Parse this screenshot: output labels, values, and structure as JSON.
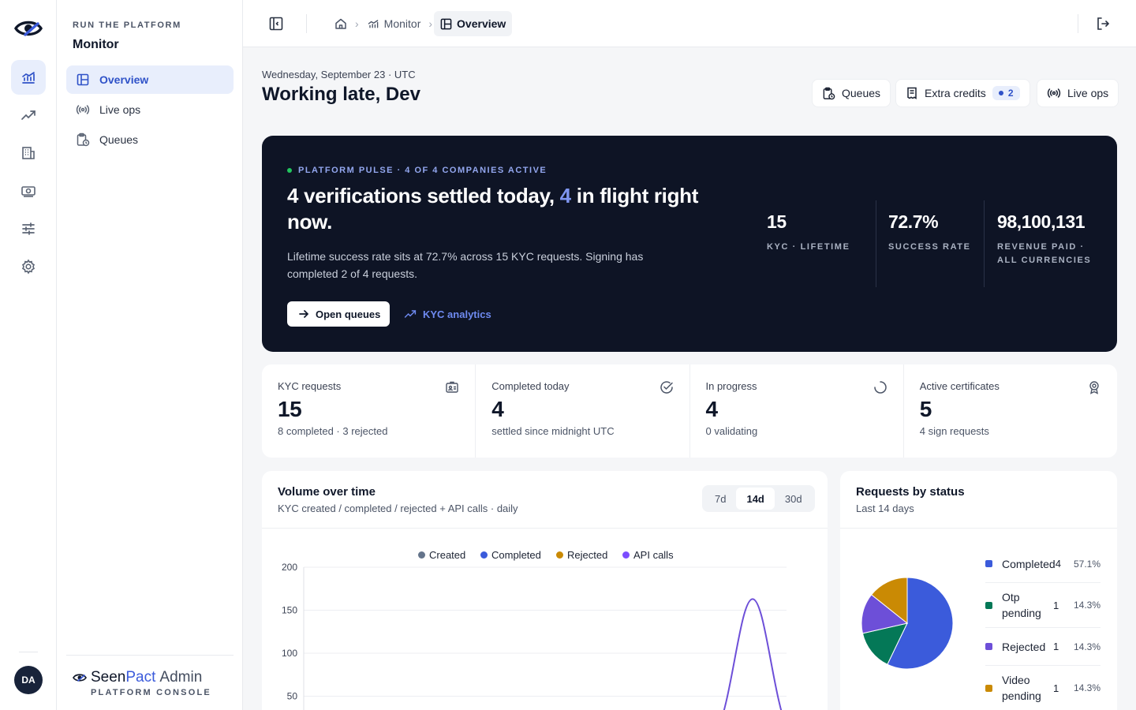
{
  "colors": {
    "accent": "#3b5bdb",
    "hero_bg": "#0e1425",
    "created": "#64748b",
    "completed": "#3b5bdb",
    "rejected": "#ca8a04",
    "api": "#7c4dff",
    "otp": "#047857",
    "video": "#ca8a04",
    "rejected_status": "#6d4fd8"
  },
  "rail": {
    "avatar": "DA"
  },
  "sidenav": {
    "eyebrow": "RUN THE PLATFORM",
    "title": "Monitor",
    "items": [
      {
        "label": "Overview",
        "icon": "layout-icon"
      },
      {
        "label": "Live ops",
        "icon": "broadcast-icon"
      },
      {
        "label": "Queues",
        "icon": "clipboard-clock-icon"
      }
    ],
    "brand_seen": "Seen",
    "brand_pact": "Pact",
    "brand_admin": "Admin",
    "brand_sub": "PLATFORM CONSOLE"
  },
  "topbar": {
    "crumbs": [
      {
        "label": "Monitor"
      },
      {
        "label": "Overview"
      }
    ]
  },
  "header": {
    "date": "Wednesday, September 23 · UTC",
    "greeting": "Working late, Dev",
    "buttons": {
      "queues": "Queues",
      "extra_credits": "Extra credits",
      "extra_credits_count": "2",
      "live_ops": "Live ops"
    }
  },
  "hero": {
    "pulse": "PLATFORM PULSE · 4 OF 4 COMPANIES ACTIVE",
    "headline_a": "4 verifications settled today, ",
    "headline_accent": "4",
    "headline_b": " in flight right now.",
    "body": "Lifetime success rate sits at 72.7% across 15 KYC requests. Signing has completed 2 of 4 requests.",
    "open_queues": "Open queues",
    "kyc_analytics": "KYC analytics",
    "stats": [
      {
        "value": "15",
        "label": "KYC · LIFETIME"
      },
      {
        "value": "72.7%",
        "label": "SUCCESS RATE"
      },
      {
        "value": "98,100,131",
        "label": "REVENUE PAID · ALL CURRENCIES"
      }
    ]
  },
  "kpis": [
    {
      "label": "KYC requests",
      "value": "15",
      "sub": "8 completed · 3 rejected",
      "icon": "id-card-icon"
    },
    {
      "label": "Completed today",
      "value": "4",
      "sub": "settled since midnight UTC",
      "icon": "check-circle-icon"
    },
    {
      "label": "In progress",
      "value": "4",
      "sub": "0 validating",
      "icon": "spinner-icon"
    },
    {
      "label": "Active certificates",
      "value": "5",
      "sub": "4 sign requests",
      "icon": "award-icon"
    }
  ],
  "volume": {
    "title": "Volume over time",
    "subtitle": "KYC created / completed / rejected + API calls · daily",
    "ranges": [
      "7d",
      "14d",
      "30d"
    ],
    "selected_range": "14d"
  },
  "status": {
    "title": "Requests by status",
    "subtitle": "Last 14 days",
    "items": [
      {
        "name": "Completed",
        "count": "4",
        "pct": "57.1%"
      },
      {
        "name": "Otp pending",
        "count": "1",
        "pct": "14.3%"
      },
      {
        "name": "Rejected",
        "count": "1",
        "pct": "14.3%"
      },
      {
        "name": "Video pending",
        "count": "1",
        "pct": "14.3%"
      }
    ]
  },
  "chart_data": [
    {
      "type": "line",
      "legend": [
        "Created",
        "Completed",
        "Rejected",
        "API calls"
      ],
      "y_ticks": [
        "200",
        "150",
        "100",
        "50"
      ],
      "ylim": [
        0,
        200
      ],
      "series": [
        {
          "name": "API calls",
          "peak": 163
        }
      ],
      "legend_position": "top-center",
      "grid": true
    },
    {
      "type": "pie",
      "slices": [
        {
          "name": "Completed",
          "value": 4
        },
        {
          "name": "Otp pending",
          "value": 1
        },
        {
          "name": "Rejected",
          "value": 1
        },
        {
          "name": "Video pending",
          "value": 1
        }
      ]
    }
  ]
}
